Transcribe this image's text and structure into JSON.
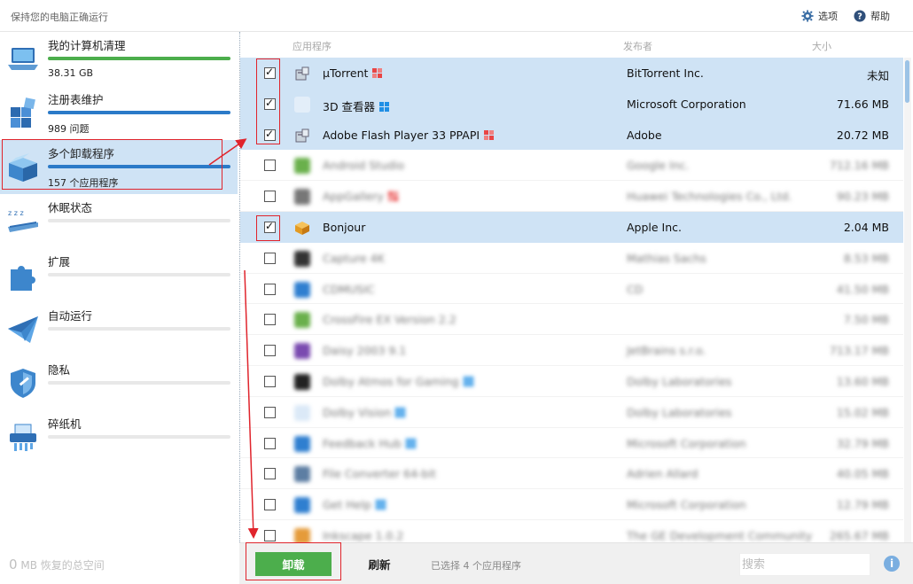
{
  "app": {
    "title": "保持您的电脑正确运行"
  },
  "top": {
    "options_label": "选项",
    "help_label": "帮助"
  },
  "sidebar": {
    "items": [
      {
        "label": "我的计算机清理",
        "sub": "38.31 GB",
        "progress": 1.0,
        "color": "#4cae4c"
      },
      {
        "label": "注册表维护",
        "sub": "989 问题",
        "progress": 1.0,
        "color": "#2b7ac8"
      },
      {
        "label": "多个卸载程序",
        "sub": "157 个应用程序",
        "progress": 1.0,
        "color": "#2b7ac8",
        "active": true
      },
      {
        "label": "休眠状态",
        "sub": "",
        "progress": 0,
        "color": "#2b7ac8"
      },
      {
        "label": "扩展",
        "sub": "",
        "progress": 0,
        "color": "#2b7ac8"
      },
      {
        "label": "自动运行",
        "sub": "",
        "progress": 0,
        "color": "#2b7ac8"
      },
      {
        "label": "隐私",
        "sub": "",
        "progress": 0,
        "color": "#2b7ac8"
      },
      {
        "label": "碎纸机",
        "sub": "",
        "progress": 0,
        "color": "#2b7ac8"
      }
    ],
    "recovered_num": "0",
    "recovered_text": "MB 恢复的总空间"
  },
  "list": {
    "col_app": "应用程序",
    "col_publisher": "发布者",
    "col_size": "大小",
    "rows": [
      {
        "name": "µTorrent",
        "publisher": "BitTorrent Inc.",
        "size": "未知",
        "checked": true,
        "icon": "installer-icon",
        "badge": "flag-red"
      },
      {
        "name": "3D 查看器",
        "publisher": "Microsoft Corporation",
        "size": "71.66 MB",
        "checked": true,
        "icon": "blank-icon",
        "badge": "windows"
      },
      {
        "name": "Adobe Flash Player 33 PPAPI",
        "publisher": "Adobe",
        "size": "20.72 MB",
        "checked": true,
        "icon": "installer-icon",
        "badge": "flag-red"
      },
      {
        "name": "Android Studio",
        "publisher": "Google Inc.",
        "size": "712.16 MB",
        "checked": false,
        "icon": "green",
        "blurred": true
      },
      {
        "name": "AppGallery",
        "publisher": "Huawei Technologies Co., Ltd.",
        "size": "90.23 MB",
        "checked": false,
        "icon": "gray",
        "blurred": true,
        "badge": "flag-red"
      },
      {
        "name": "Bonjour",
        "publisher": "Apple Inc.",
        "size": "2.04 MB",
        "checked": true,
        "icon": "bonjour-icon"
      },
      {
        "name": "Capture 4K",
        "publisher": "Mathias Sachs",
        "size": "8.53 MB",
        "checked": false,
        "icon": "dark",
        "blurred": true
      },
      {
        "name": "CDMUSIC",
        "publisher": "CD",
        "size": "41.50 MB",
        "checked": false,
        "icon": "blue",
        "blurred": true
      },
      {
        "name": "CrossFire EX Version 2.2",
        "publisher": "",
        "size": "7.50 MB",
        "checked": false,
        "icon": "green",
        "blurred": true
      },
      {
        "name": "Daisy 2003 9.1",
        "publisher": "JetBrains s.r.o.",
        "size": "713.17 MB",
        "checked": false,
        "icon": "purple",
        "blurred": true
      },
      {
        "name": "Dolby Atmos for Gaming",
        "publisher": "Dolby Laboratories",
        "size": "13.60 MB",
        "checked": false,
        "icon": "black",
        "blurred": true,
        "badge": "windows"
      },
      {
        "name": "Dolby Vision",
        "publisher": "Dolby Laboratories",
        "size": "15.02 MB",
        "checked": false,
        "icon": "light",
        "blurred": true,
        "badge": "windows"
      },
      {
        "name": "Feedback Hub",
        "publisher": "Microsoft Corporation",
        "size": "32.79 MB",
        "checked": false,
        "icon": "blue",
        "blurred": true,
        "badge": "windows"
      },
      {
        "name": "File Converter 64-bit",
        "publisher": "Adrien Allard",
        "size": "40.05 MB",
        "checked": false,
        "icon": "steel",
        "blurred": true
      },
      {
        "name": "Get Help",
        "publisher": "Microsoft Corporation",
        "size": "12.79 MB",
        "checked": false,
        "icon": "blue",
        "blurred": true,
        "badge": "windows"
      },
      {
        "name": "Inkscape 1.0.2",
        "publisher": "The GE Development Community",
        "size": "265.67 MB",
        "checked": false,
        "icon": "multi",
        "blurred": true
      }
    ]
  },
  "toolbar": {
    "uninstall_label": "卸载",
    "refresh_label": "刷新",
    "status": "已选择 4 个应用程序",
    "search_placeholder": "搜索",
    "info_glyph": "i"
  }
}
